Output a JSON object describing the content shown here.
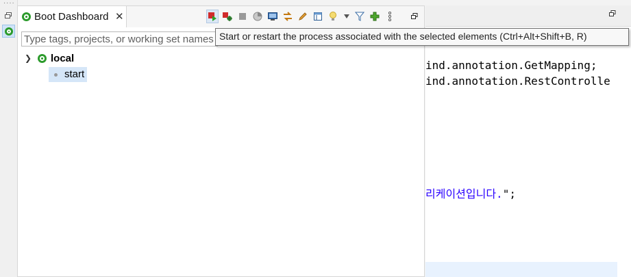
{
  "boot_dashboard": {
    "tab_label": "Boot Dashboard",
    "toolbar_icons": [
      "start-restart-icon",
      "debug-restart-icon",
      "stop-icon",
      "open-console-icon",
      "open-browser-icon",
      "navigate-icon",
      "edit-icon",
      "properties-icon",
      "live-hover-icon",
      "view-menu-icon",
      "filter-icon",
      "add-target-icon",
      "more-icon",
      "maximize-icon"
    ],
    "filter_placeholder": "Type tags, projects, or working set names to match (incl. * and ? wildcards)",
    "tree": {
      "group_label": "local",
      "items": [
        {
          "label": "start",
          "selected": true
        }
      ]
    }
  },
  "tooltip": {
    "text": "Start or restart the process associated with the selected elements (Ctrl+Alt+Shift+B, R)"
  },
  "editor": {
    "code_lines": [
      "ind.annotation.GetMapping;",
      "ind.annotation.RestControlle"
    ],
    "string_line_text": "리케이션입니다.",
    "string_line_suffix": "\";"
  },
  "colors": {
    "spring_green": "#2c9b2c",
    "selection": "#d5e6f8",
    "string_literal": "#2a00ff"
  }
}
